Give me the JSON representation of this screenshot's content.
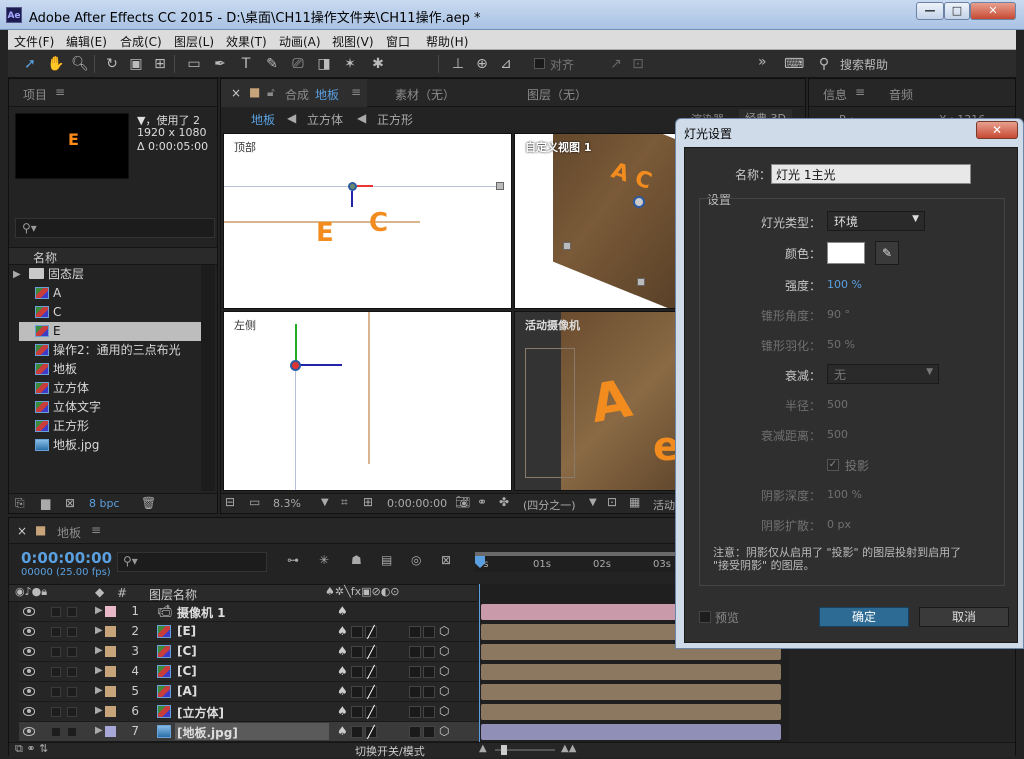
{
  "window": {
    "app_icon": "Ae",
    "title": "Adobe After Effects CC 2015 - D:\\桌面\\CH11操作文件夹\\CH11操作.aep *",
    "minimize": "—",
    "maximize": "□",
    "close": "✕"
  },
  "menu": [
    "文件(F)",
    "编辑(E)",
    "合成(C)",
    "图层(L)",
    "效果(T)",
    "动画(A)",
    "视图(V)",
    "窗口",
    "帮助(H)"
  ],
  "toolbar": {
    "snap_label": "对齐",
    "search_help": "搜索帮助",
    "expand": "»"
  },
  "project": {
    "tab": "项目",
    "preview_letter": "E",
    "info_line1": "▼，使用了 2",
    "info_line2": "1920 x 1080",
    "info_line3": "Δ 0:00:05:00",
    "search_placeholder": "",
    "column_name": "名称",
    "items": [
      {
        "name": "固态层",
        "type": "folder"
      },
      {
        "name": "A",
        "type": "comp"
      },
      {
        "name": "C",
        "type": "comp"
      },
      {
        "name": "E",
        "type": "comp",
        "selected": true
      },
      {
        "name": "操作2：通用的三点布光",
        "type": "comp"
      },
      {
        "name": "地板",
        "type": "comp"
      },
      {
        "name": "立方体",
        "type": "comp"
      },
      {
        "name": "立体文字",
        "type": "comp"
      },
      {
        "name": "正方形",
        "type": "comp"
      },
      {
        "name": "地板.jpg",
        "type": "image"
      }
    ],
    "bpc": "8 bpc"
  },
  "composition": {
    "tab_prefix": "合成",
    "tab_name": "地板",
    "footage_tab": "素材（无）",
    "layer_tab": "图层（无）",
    "breadcrumbs": [
      "地板",
      "立方体",
      "正方形"
    ],
    "renderer_label": "渲染器",
    "renderer_value": "经典 3D",
    "views": {
      "top": "顶部",
      "custom": "自定义视图 1",
      "left": "左侧",
      "active_camera": "活动摄像机"
    },
    "zoom": "8.3%",
    "timecode": "0:00:00:00",
    "resolution": "(四分之一)",
    "active_label": "活动"
  },
  "right_panels": {
    "info": "信息",
    "audio": "音频",
    "info_r": "R :",
    "info_x": "X : 1316"
  },
  "dialog": {
    "title": "灯光设置",
    "name_label": "名称：",
    "name_value": "灯光 1主光",
    "section": "设置",
    "type_label": "灯光类型：",
    "type_value": "环境",
    "color_label": "颜色：",
    "intensity_label": "强度：",
    "intensity_value": "100 %",
    "cone_angle_label": "锥形角度：",
    "cone_angle_value": "90 °",
    "cone_feather_label": "锥形羽化：",
    "cone_feather_value": "50 %",
    "falloff_label": "衰减：",
    "falloff_value": "无",
    "radius_label": "半径：",
    "radius_value": "500",
    "falloff_distance_label": "衰减距离：",
    "falloff_distance_value": "500",
    "shadow_label": "投影",
    "shadow_darkness_label": "阴影深度：",
    "shadow_darkness_value": "100 %",
    "shadow_diffusion_label": "阴影扩散：",
    "shadow_diffusion_value": "0 px",
    "note": "注意：阴影仅从启用了 \"投影\" 的图层投射到启用了 \"接受阴影\" 的图层。",
    "preview_label": "预览",
    "ok": "确定",
    "cancel": "取消",
    "colors": {
      "accent": "#2d6a94",
      "swatch": "#ffffff"
    }
  },
  "timeline": {
    "tab": "地板",
    "timecode": "0:00:00:00",
    "frames": "00000 (25.00 fps)",
    "col_hash": "#",
    "col_name": "图层名称",
    "ruler": [
      "0s",
      "01s",
      "02s",
      "03s"
    ],
    "footer_toggle": "切换开关/模式",
    "layers": [
      {
        "num": "1",
        "name": "摄像机 1",
        "color": "#e8b7c8",
        "type": "camera"
      },
      {
        "num": "2",
        "name": "[E]",
        "color": "#c8a47a",
        "type": "comp"
      },
      {
        "num": "3",
        "name": "[C]",
        "color": "#c8a47a",
        "type": "comp"
      },
      {
        "num": "4",
        "name": "[C]",
        "color": "#c8a47a",
        "type": "comp"
      },
      {
        "num": "5",
        "name": "[A]",
        "color": "#c8a47a",
        "type": "comp"
      },
      {
        "num": "6",
        "name": "[立方体]",
        "color": "#c8a47a",
        "type": "comp"
      },
      {
        "num": "7",
        "name": "[地板.jpg]",
        "color": "#a7a7d8",
        "type": "image",
        "selected": true
      }
    ]
  }
}
